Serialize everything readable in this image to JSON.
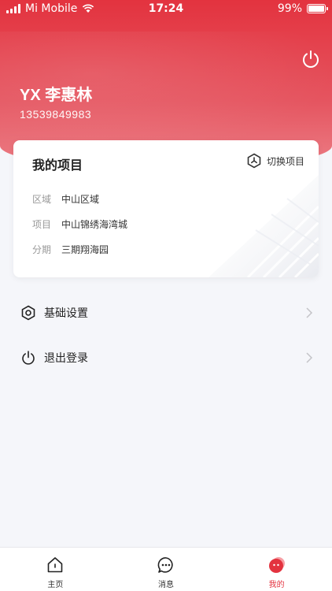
{
  "status_bar": {
    "carrier": "Mi Mobile",
    "time": "17:24",
    "battery": "99%"
  },
  "profile": {
    "name": "YX 李惠林",
    "phone": "13539849983"
  },
  "project_card": {
    "title": "我的项目",
    "switch_label": "切换项目",
    "rows": [
      {
        "label": "区域",
        "value": "中山区域"
      },
      {
        "label": "项目",
        "value": "中山锦绣海湾城"
      },
      {
        "label": "分期",
        "value": "三期翔海园"
      }
    ]
  },
  "menu": {
    "settings_label": "基础设置",
    "logout_label": "退出登录"
  },
  "tabbar": {
    "tabs": [
      {
        "label": "主页",
        "icon": "home-icon"
      },
      {
        "label": "消息",
        "icon": "message-icon"
      },
      {
        "label": "我的",
        "icon": "profile-avatar-icon"
      }
    ],
    "active": 2
  },
  "colors": {
    "brand": "#e3333f",
    "background": "#f5f6fa"
  }
}
